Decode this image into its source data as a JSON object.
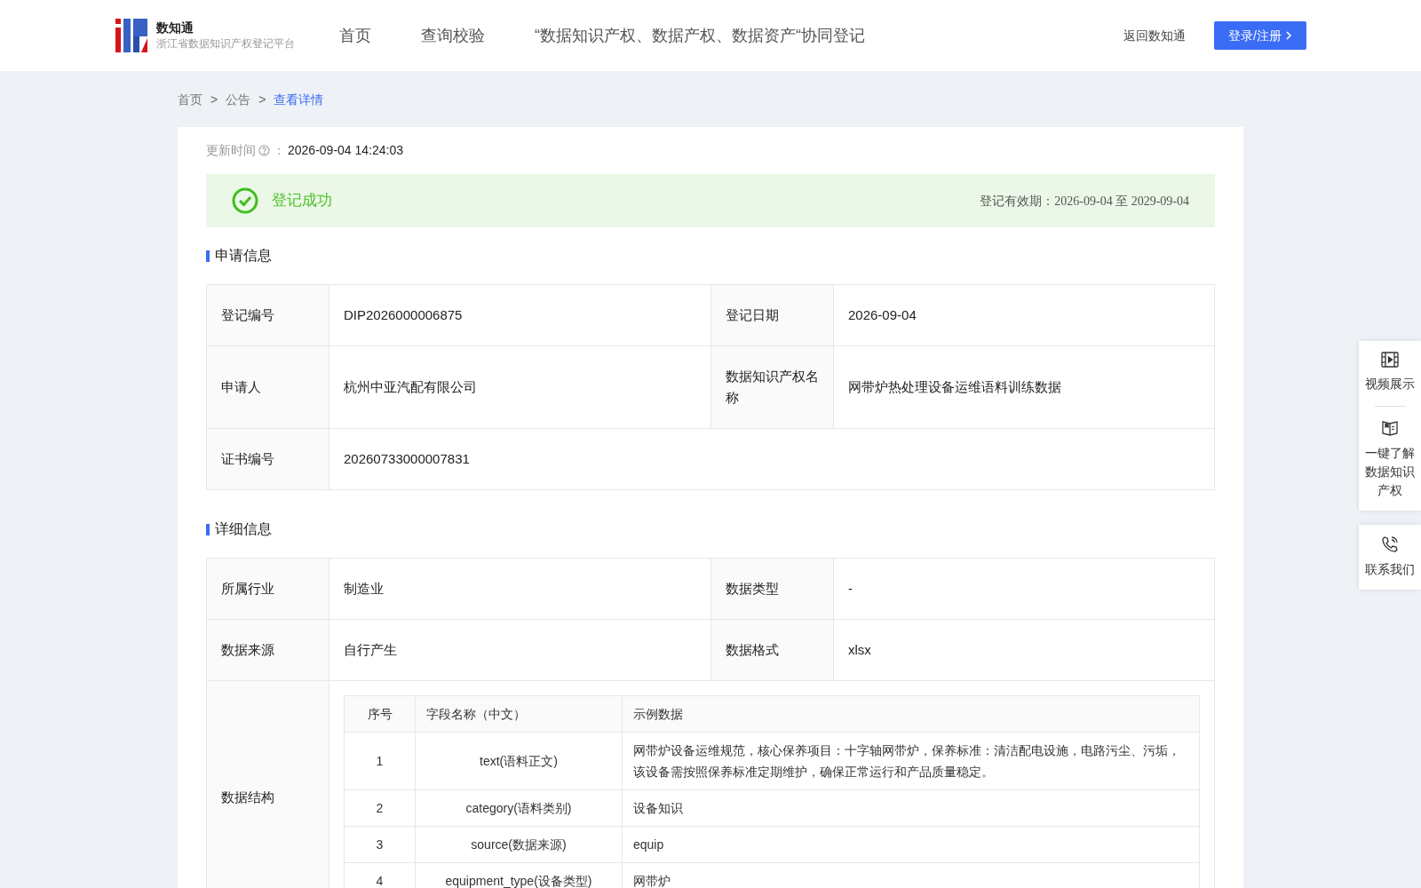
{
  "header": {
    "logo_title": "数知通",
    "logo_subtitle": "浙江省数据知识产权登记平台",
    "nav": [
      {
        "label": "首页",
        "selected": false
      },
      {
        "label": "查询校验",
        "selected": false
      },
      {
        "label": "“数据知识产权、数据产权、数据资产“协同登记",
        "selected": false
      }
    ],
    "back_link": "返回数知通",
    "login_button": "登录/注册"
  },
  "breadcrumb": {
    "separator": ">",
    "items": [
      {
        "label": "首页",
        "selected": false
      },
      {
        "label": "公告",
        "selected": false
      },
      {
        "label": "查看详情",
        "selected": true
      }
    ]
  },
  "update": {
    "label": "更新时间",
    "separator": "：",
    "value": "2026-09-04 14:24:03"
  },
  "status": {
    "text": "登记成功",
    "validity": "登记有效期：2026-09-04 至 2029-09-04"
  },
  "sections": [
    {
      "title": "申请信息",
      "rows": [
        [
          {
            "label": "登记编号",
            "value": "DIP2026000006875"
          },
          {
            "label": "登记日期",
            "value": "2026-09-04"
          }
        ],
        [
          {
            "label": "申请人",
            "value": "杭州中亚汽配有限公司"
          },
          {
            "label": "数据知识产权名称",
            "value": "网带炉热处理设备运维语料训练数据"
          }
        ],
        [
          {
            "label": "证书编号",
            "value": "20260733000007831"
          }
        ]
      ]
    },
    {
      "title": "详细信息",
      "rows": [
        [
          {
            "label": "所属行业",
            "value": "制造业"
          },
          {
            "label": "数据类型",
            "value": "-"
          }
        ],
        [
          {
            "label": "数据来源",
            "value": "自行产生"
          },
          {
            "label": "数据格式",
            "value": "xlsx"
          }
        ]
      ],
      "structure": {
        "label": "数据结构",
        "columns": [
          "序号",
          "字段名称（中文）",
          "示例数据"
        ],
        "rows": [
          [
            "1",
            "text(语料正文)",
            "网带炉设备运维规范，核心保养项目：十字轴网带炉，保养标准：清洁配电设施，电路污尘、污垢，该设备需按照保养标准定期维护，确保正常运行和产品质量稳定。"
          ],
          [
            "2",
            "category(语料类别)",
            "设备知识"
          ],
          [
            "3",
            "source(数据来源)",
            "equip"
          ],
          [
            "4",
            "equipment_type(设备类型)",
            "网带炉"
          ]
        ]
      }
    }
  ],
  "side_panel": [
    {
      "kind": "video",
      "label": "视频展示"
    },
    {
      "kind": "book",
      "label": "一键了解数据知识产权"
    },
    {
      "kind": "phone",
      "label": "联系我们"
    }
  ]
}
